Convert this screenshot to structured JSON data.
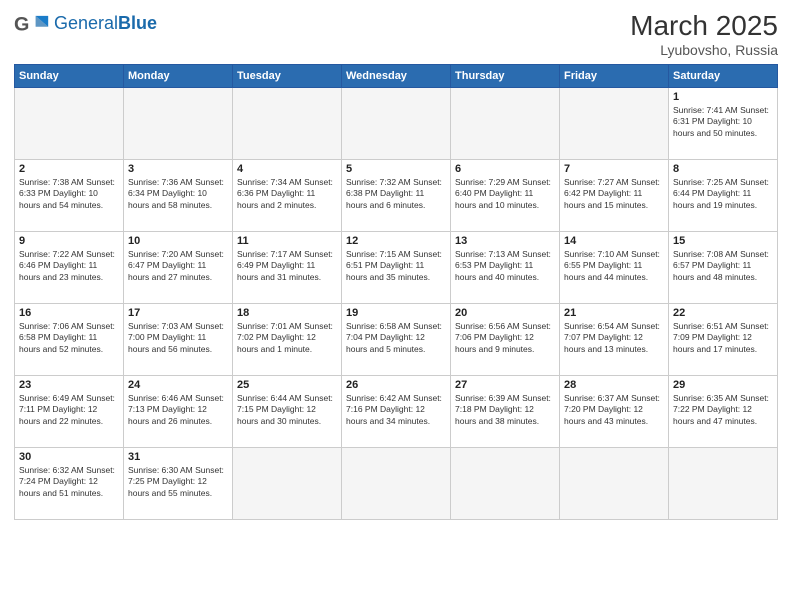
{
  "header": {
    "logo_general": "General",
    "logo_blue": "Blue",
    "month_year": "March 2025",
    "location": "Lyubovsho, Russia"
  },
  "days_of_week": [
    "Sunday",
    "Monday",
    "Tuesday",
    "Wednesday",
    "Thursday",
    "Friday",
    "Saturday"
  ],
  "weeks": [
    [
      {
        "day": "",
        "info": ""
      },
      {
        "day": "",
        "info": ""
      },
      {
        "day": "",
        "info": ""
      },
      {
        "day": "",
        "info": ""
      },
      {
        "day": "",
        "info": ""
      },
      {
        "day": "",
        "info": ""
      },
      {
        "day": "1",
        "info": "Sunrise: 7:41 AM\nSunset: 6:31 PM\nDaylight: 10 hours\nand 50 minutes."
      }
    ],
    [
      {
        "day": "2",
        "info": "Sunrise: 7:38 AM\nSunset: 6:33 PM\nDaylight: 10 hours\nand 54 minutes."
      },
      {
        "day": "3",
        "info": "Sunrise: 7:36 AM\nSunset: 6:34 PM\nDaylight: 10 hours\nand 58 minutes."
      },
      {
        "day": "4",
        "info": "Sunrise: 7:34 AM\nSunset: 6:36 PM\nDaylight: 11 hours\nand 2 minutes."
      },
      {
        "day": "5",
        "info": "Sunrise: 7:32 AM\nSunset: 6:38 PM\nDaylight: 11 hours\nand 6 minutes."
      },
      {
        "day": "6",
        "info": "Sunrise: 7:29 AM\nSunset: 6:40 PM\nDaylight: 11 hours\nand 10 minutes."
      },
      {
        "day": "7",
        "info": "Sunrise: 7:27 AM\nSunset: 6:42 PM\nDaylight: 11 hours\nand 15 minutes."
      },
      {
        "day": "8",
        "info": "Sunrise: 7:25 AM\nSunset: 6:44 PM\nDaylight: 11 hours\nand 19 minutes."
      }
    ],
    [
      {
        "day": "9",
        "info": "Sunrise: 7:22 AM\nSunset: 6:46 PM\nDaylight: 11 hours\nand 23 minutes."
      },
      {
        "day": "10",
        "info": "Sunrise: 7:20 AM\nSunset: 6:47 PM\nDaylight: 11 hours\nand 27 minutes."
      },
      {
        "day": "11",
        "info": "Sunrise: 7:17 AM\nSunset: 6:49 PM\nDaylight: 11 hours\nand 31 minutes."
      },
      {
        "day": "12",
        "info": "Sunrise: 7:15 AM\nSunset: 6:51 PM\nDaylight: 11 hours\nand 35 minutes."
      },
      {
        "day": "13",
        "info": "Sunrise: 7:13 AM\nSunset: 6:53 PM\nDaylight: 11 hours\nand 40 minutes."
      },
      {
        "day": "14",
        "info": "Sunrise: 7:10 AM\nSunset: 6:55 PM\nDaylight: 11 hours\nand 44 minutes."
      },
      {
        "day": "15",
        "info": "Sunrise: 7:08 AM\nSunset: 6:57 PM\nDaylight: 11 hours\nand 48 minutes."
      }
    ],
    [
      {
        "day": "16",
        "info": "Sunrise: 7:06 AM\nSunset: 6:58 PM\nDaylight: 11 hours\nand 52 minutes."
      },
      {
        "day": "17",
        "info": "Sunrise: 7:03 AM\nSunset: 7:00 PM\nDaylight: 11 hours\nand 56 minutes."
      },
      {
        "day": "18",
        "info": "Sunrise: 7:01 AM\nSunset: 7:02 PM\nDaylight: 12 hours\nand 1 minute."
      },
      {
        "day": "19",
        "info": "Sunrise: 6:58 AM\nSunset: 7:04 PM\nDaylight: 12 hours\nand 5 minutes."
      },
      {
        "day": "20",
        "info": "Sunrise: 6:56 AM\nSunset: 7:06 PM\nDaylight: 12 hours\nand 9 minutes."
      },
      {
        "day": "21",
        "info": "Sunrise: 6:54 AM\nSunset: 7:07 PM\nDaylight: 12 hours\nand 13 minutes."
      },
      {
        "day": "22",
        "info": "Sunrise: 6:51 AM\nSunset: 7:09 PM\nDaylight: 12 hours\nand 17 minutes."
      }
    ],
    [
      {
        "day": "23",
        "info": "Sunrise: 6:49 AM\nSunset: 7:11 PM\nDaylight: 12 hours\nand 22 minutes."
      },
      {
        "day": "24",
        "info": "Sunrise: 6:46 AM\nSunset: 7:13 PM\nDaylight: 12 hours\nand 26 minutes."
      },
      {
        "day": "25",
        "info": "Sunrise: 6:44 AM\nSunset: 7:15 PM\nDaylight: 12 hours\nand 30 minutes."
      },
      {
        "day": "26",
        "info": "Sunrise: 6:42 AM\nSunset: 7:16 PM\nDaylight: 12 hours\nand 34 minutes."
      },
      {
        "day": "27",
        "info": "Sunrise: 6:39 AM\nSunset: 7:18 PM\nDaylight: 12 hours\nand 38 minutes."
      },
      {
        "day": "28",
        "info": "Sunrise: 6:37 AM\nSunset: 7:20 PM\nDaylight: 12 hours\nand 43 minutes."
      },
      {
        "day": "29",
        "info": "Sunrise: 6:35 AM\nSunset: 7:22 PM\nDaylight: 12 hours\nand 47 minutes."
      }
    ],
    [
      {
        "day": "30",
        "info": "Sunrise: 6:32 AM\nSunset: 7:24 PM\nDaylight: 12 hours\nand 51 minutes."
      },
      {
        "day": "31",
        "info": "Sunrise: 6:30 AM\nSunset: 7:25 PM\nDaylight: 12 hours\nand 55 minutes."
      },
      {
        "day": "",
        "info": ""
      },
      {
        "day": "",
        "info": ""
      },
      {
        "day": "",
        "info": ""
      },
      {
        "day": "",
        "info": ""
      },
      {
        "day": "",
        "info": ""
      }
    ]
  ]
}
